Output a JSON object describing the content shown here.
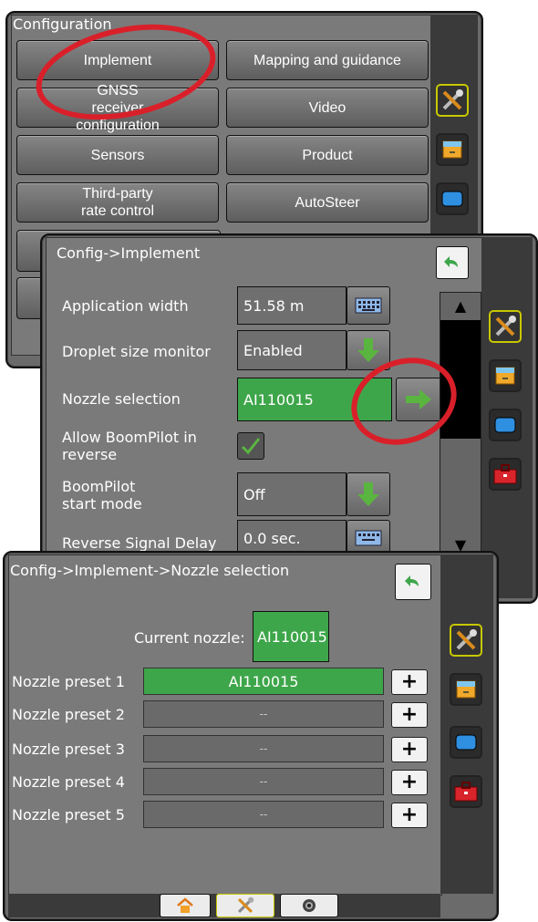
{
  "config_panel": {
    "title": "Configuration",
    "buttons": [
      {
        "label": "Implement"
      },
      {
        "label": "Mapping and guidance"
      },
      {
        "label": "GNSS receiver configuration"
      },
      {
        "label": "Video"
      },
      {
        "label": "Sensors"
      },
      {
        "label": "Product"
      },
      {
        "label": "Third-party rate control"
      },
      {
        "label": "AutoSteer"
      }
    ]
  },
  "implement_panel": {
    "title": "Config->Implement",
    "rows": [
      {
        "label": "Application width",
        "value": "51.58 m",
        "control": "keyboard-icon"
      },
      {
        "label": "Droplet size monitor",
        "value": "Enabled",
        "control": "down-arrow-icon"
      },
      {
        "label": "Nozzle selection",
        "value": "AI110015",
        "control": "right-arrow-icon"
      },
      {
        "label": "Allow BoomPilot in reverse",
        "value": "",
        "control": "checkmark-icon"
      },
      {
        "label": "BoomPilot start mode",
        "value": "Off",
        "control": "down-arrow-icon"
      },
      {
        "label": "Reverse Signal Delay",
        "value": "0.0 sec.",
        "control": "keyboard-icon"
      }
    ]
  },
  "nozzle_panel": {
    "title": "Config->Implement->Nozzle selection",
    "current_label": "Current nozzle:",
    "current_value": "AI110015",
    "presets": [
      {
        "label": "Nozzle preset 1",
        "value": "AI110015"
      },
      {
        "label": "Nozzle preset 2",
        "value": "--"
      },
      {
        "label": "Nozzle preset 3",
        "value": "--"
      },
      {
        "label": "Nozzle preset 4",
        "value": "--"
      },
      {
        "label": "Nozzle preset 5",
        "value": "--"
      }
    ],
    "plus_label": "+"
  },
  "colors": {
    "accent_green": "#3ea64a",
    "highlight_red": "#d9202a",
    "selected_outline": "#c8c800"
  }
}
